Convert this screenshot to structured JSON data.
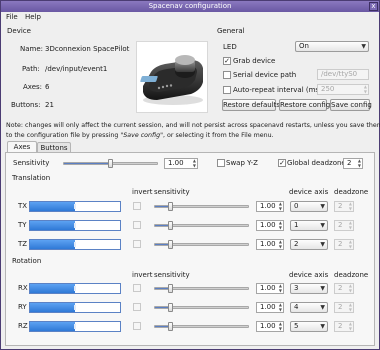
{
  "window": {
    "title": "Spacenav configuration",
    "close_glyph": "x"
  },
  "menu": {
    "file": "File",
    "help": "Help"
  },
  "device": {
    "group_title": "Device",
    "name_label": "Name:",
    "name_value": "3Dconnexion SpacePilot",
    "path_label": "Path:",
    "path_value": "/dev/input/event1",
    "axes_label": "Axes:",
    "axes_value": "6",
    "buttons_label": "Buttons:",
    "buttons_value": "21",
    "image_icon": "spacemouse-device-image"
  },
  "general": {
    "group_title": "General",
    "led_label": "LED",
    "led_value": "On",
    "grab_device": {
      "label": "Grab device",
      "checked": true
    },
    "serial_path": {
      "label": "Serial device path",
      "checked": false,
      "value": "/dev/ttyS0"
    },
    "auto_repeat": {
      "label": "Auto-repeat interval (ms)",
      "checked": false,
      "value": "250"
    },
    "restore_defaults": "Restore defaults",
    "restore_config": "Restore config",
    "save_config": "Save config"
  },
  "note": {
    "line1": "Note: changes will only affect the current session, and will not persist across spacenavd restarts, unless you save them",
    "line2_pre": "to the configuration file by pressing \"",
    "line2_em1": "Save config",
    "line2_mid": "\", or selecting it from the File menu."
  },
  "tabs": {
    "axes": "Axes",
    "buttons": "Buttons",
    "active": "Axes"
  },
  "axes_tab": {
    "sensitivity_label": "Sensitivity",
    "sensitivity_value": "1.00",
    "sensitivity_slider": 0.5,
    "swap_yz": {
      "label": "Swap Y-Z",
      "checked": false
    },
    "global_deadzone": {
      "label": "Global deadzone",
      "checked": true,
      "value": "2"
    },
    "translation_title": "Translation",
    "rotation_title": "Rotation",
    "col_invert": "invert",
    "col_sensitivity": "sensitivity",
    "col_device_axis": "device axis",
    "col_deadzone": "deadzone",
    "translation_rows": [
      {
        "label": "TX",
        "level": 0.5,
        "invert": false,
        "slider": 0.17,
        "sens": "1.00",
        "axis": "0",
        "deadzone": "2"
      },
      {
        "label": "TY",
        "level": 0.5,
        "invert": false,
        "slider": 0.17,
        "sens": "1.00",
        "axis": "1",
        "deadzone": "2"
      },
      {
        "label": "TZ",
        "level": 0.5,
        "invert": false,
        "slider": 0.17,
        "sens": "1.00",
        "axis": "2",
        "deadzone": "2"
      }
    ],
    "rotation_rows": [
      {
        "label": "RX",
        "level": 0.5,
        "invert": false,
        "slider": 0.17,
        "sens": "1.00",
        "axis": "3",
        "deadzone": "2"
      },
      {
        "label": "RY",
        "level": 0.5,
        "invert": false,
        "slider": 0.17,
        "sens": "1.00",
        "axis": "4",
        "deadzone": "2"
      },
      {
        "label": "RZ",
        "level": 0.5,
        "invert": false,
        "slider": 0.17,
        "sens": "1.00",
        "axis": "5",
        "deadzone": "2"
      }
    ]
  },
  "colors": {
    "title_bar": "#7a68b3",
    "progress": "#3b86e0",
    "slider_fill": "#5b7fc4"
  }
}
